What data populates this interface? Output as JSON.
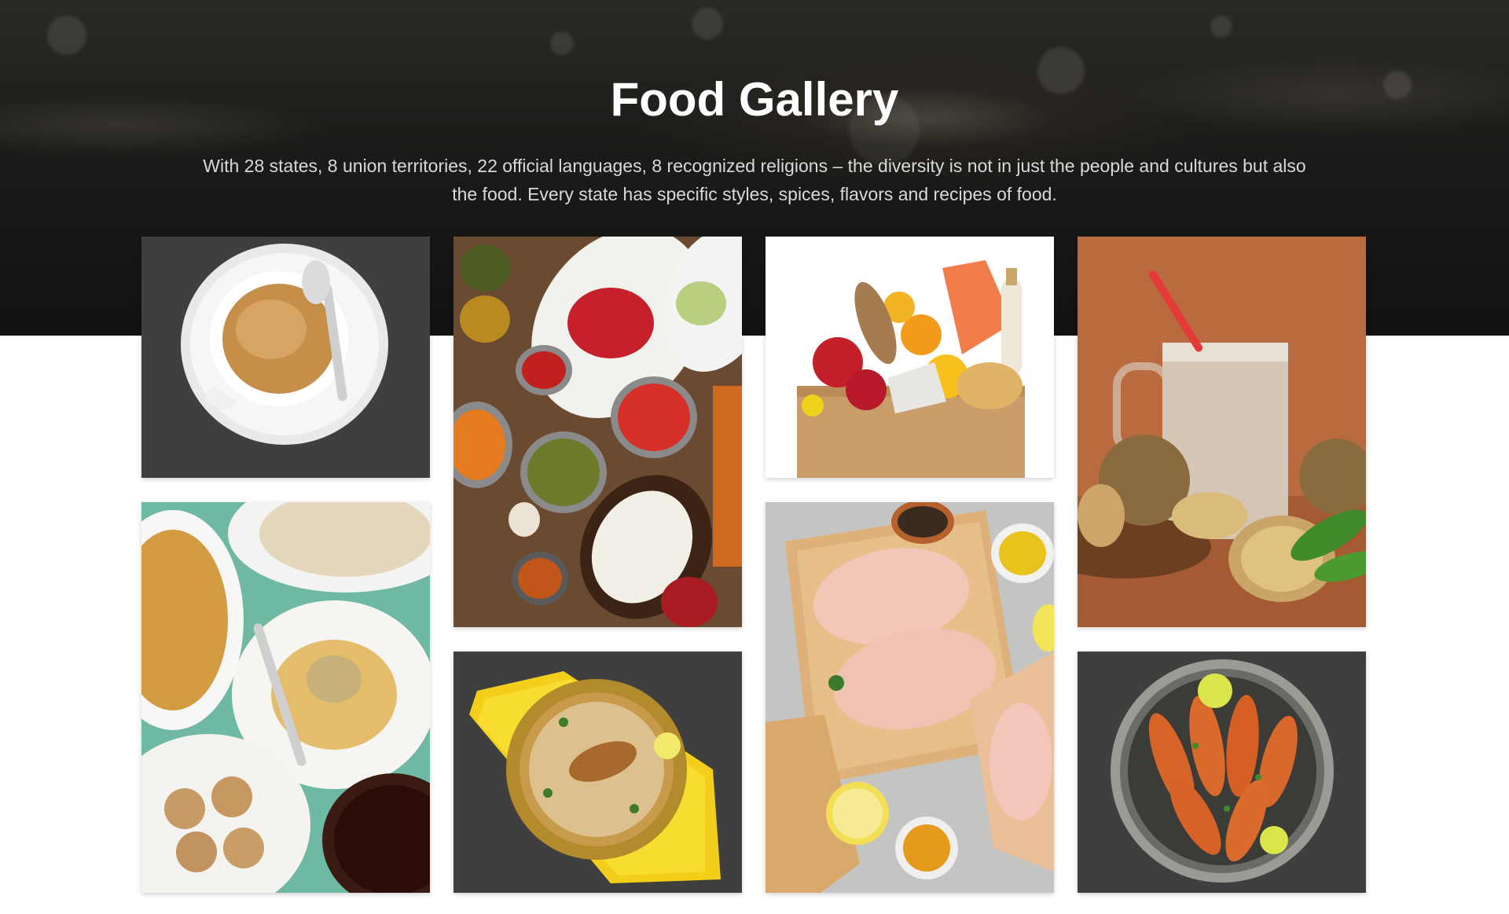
{
  "header": {
    "title": "Food Gallery",
    "description": "With 28 states, 8 union territories, 22 official languages, 8 recognized religions – the diversity is not in just the people and cultures but also the food. Every state has specific styles, spices, flavors and recipes of food."
  },
  "gallery": {
    "items": [
      {
        "image": "coffee-cup-image"
      },
      {
        "image": "indian-spread-image"
      },
      {
        "image": "grocery-bag-image"
      },
      {
        "image": "sapodilla-milkshake-image"
      },
      {
        "image": "chaat-platter-image"
      },
      {
        "image": "biryani-image"
      },
      {
        "image": "raw-chicken-image"
      },
      {
        "image": "fish-fry-image"
      }
    ]
  },
  "colors": {
    "tile_background": "#3f3f3f",
    "hero_dark": "#1c1b19",
    "title": "#ffffff",
    "subtitle": "#d9d9d9"
  }
}
